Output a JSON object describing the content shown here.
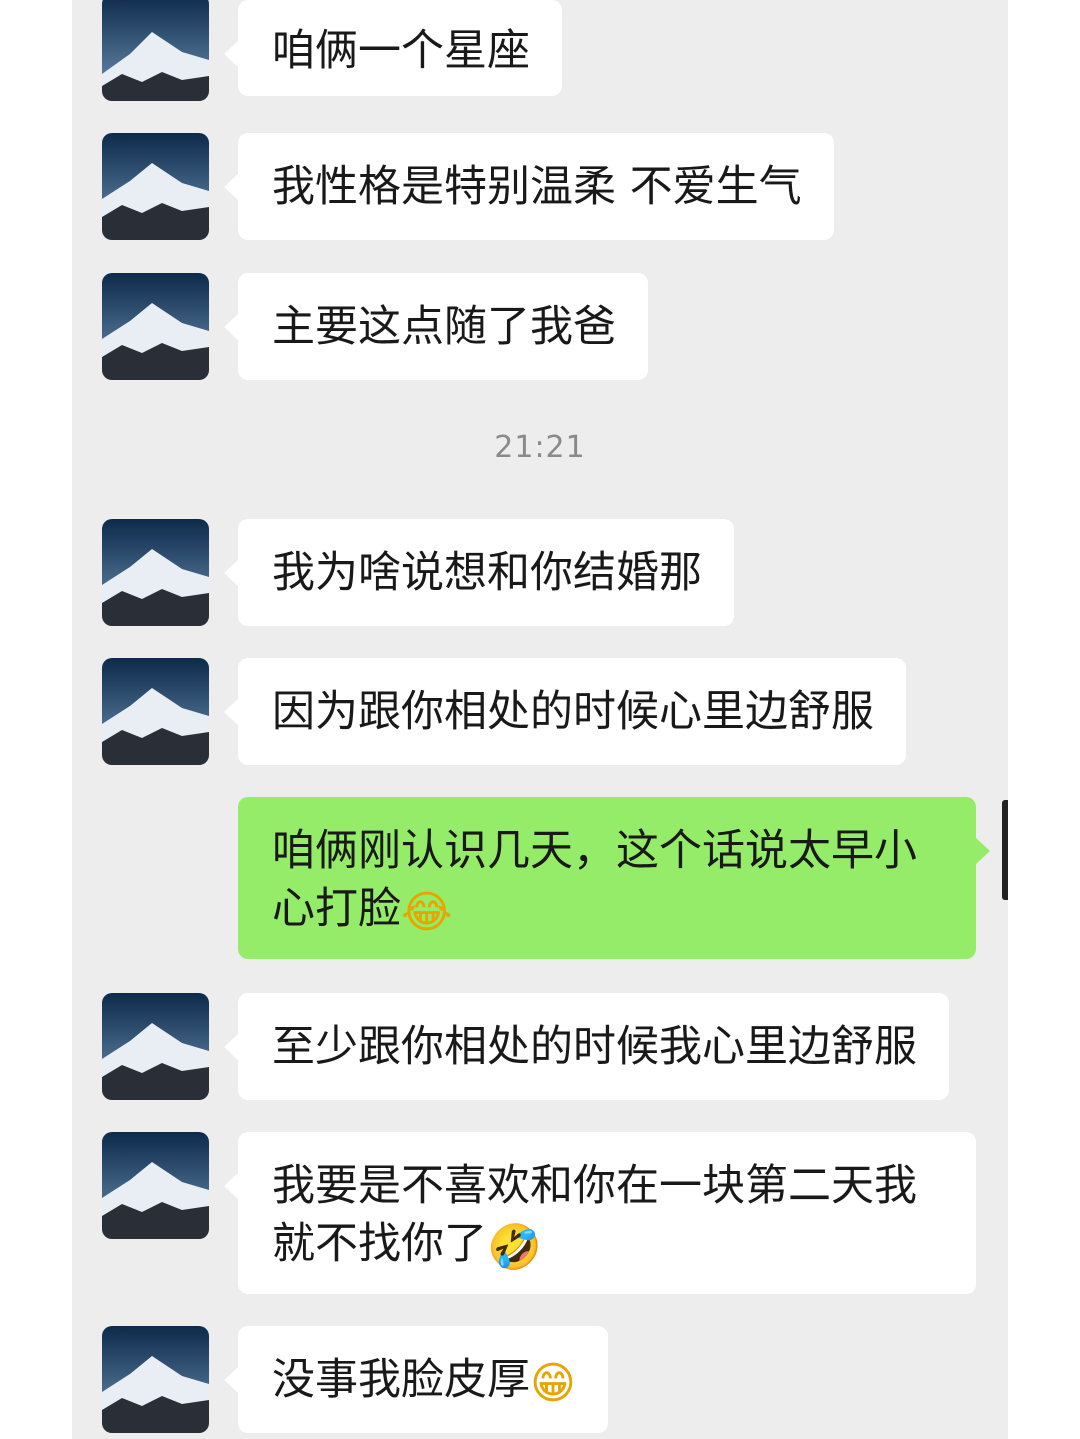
{
  "timestamp": "21:21",
  "messages": [
    {
      "side": "in",
      "text": "咱俩一个星座",
      "emoji": ""
    },
    {
      "side": "in",
      "text": "我性格是特别温柔 不爱生气",
      "emoji": ""
    },
    {
      "side": "in",
      "text": "主要这点随了我爸",
      "emoji": ""
    },
    {
      "side": "in",
      "text": "我为啥说想和你结婚那",
      "emoji": ""
    },
    {
      "side": "in",
      "text": "因为跟你相处的时候心里边舒服",
      "emoji": ""
    },
    {
      "side": "out",
      "text": "咱俩刚认识几天，这个话说太早小心打脸",
      "emoji": "😂"
    },
    {
      "side": "in",
      "text": "至少跟你相处的时候我心里边舒服",
      "emoji": ""
    },
    {
      "side": "in",
      "text": "我要是不喜欢和你在一块第二天我就不找你了",
      "emoji": "🤣"
    },
    {
      "side": "in",
      "text": "没事我脸皮厚",
      "emoji": "😁"
    }
  ],
  "icons": {
    "avatar": "snow-mountain-avatar-icon"
  },
  "colors": {
    "background": "#ededed",
    "incoming_bubble": "#ffffff",
    "outgoing_bubble": "#95ec69",
    "timestamp": "#8a8a8a"
  }
}
